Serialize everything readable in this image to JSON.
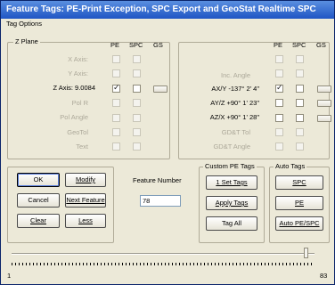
{
  "window": {
    "title": "Feature Tags: PE-Print Exception, SPC Export and GeoStat Realtime SPC"
  },
  "menu": {
    "tag_options": "Tag Options"
  },
  "left_panel": {
    "group_title": "Z Plane",
    "col_pe": "PE",
    "col_spc": "SPC",
    "col_gs": "GS",
    "rows": [
      {
        "label": "X Axis:"
      },
      {
        "label": "Y Axis:"
      },
      {
        "label": "Z Axis:  9.0084"
      },
      {
        "label": "Pol R"
      },
      {
        "label": "Pol Angle"
      },
      {
        "label": "GeoTol"
      },
      {
        "label": "Text"
      }
    ]
  },
  "right_panel": {
    "col_pe": "PE",
    "col_spc": "SPC",
    "col_gs": "GS",
    "rows": [
      {
        "label": ""
      },
      {
        "label": ""
      },
      {
        "label": "Inc. Angle"
      },
      {
        "label": "AX/Y  -137° 2' 4\""
      },
      {
        "label": "AY/Z  +90° 1' 23\""
      },
      {
        "label": "AZ/X  +90° 1' 28\""
      },
      {
        "label": "GD&T Tol"
      },
      {
        "label": "GD&T Angle"
      }
    ]
  },
  "buttons": {
    "ok": "OK",
    "modify": "Modify",
    "cancel": "Cancel",
    "next_feature": "Next Feature",
    "clear": "Clear",
    "less": "Less"
  },
  "feature_number": {
    "label": "Feature Number",
    "value": "78"
  },
  "custom_pe": {
    "title": "Custom PE Tags",
    "set_tags": "1 Set Tags",
    "apply_tags": "Apply Tags",
    "tag_all": "Tag All"
  },
  "auto_tags": {
    "title": "Auto Tags",
    "spc": "SPC",
    "pe": "PE",
    "auto_pe_spc": "Auto PE/SPC"
  },
  "slider": {
    "min": "1",
    "max": "83",
    "value_fraction": 0.98
  }
}
